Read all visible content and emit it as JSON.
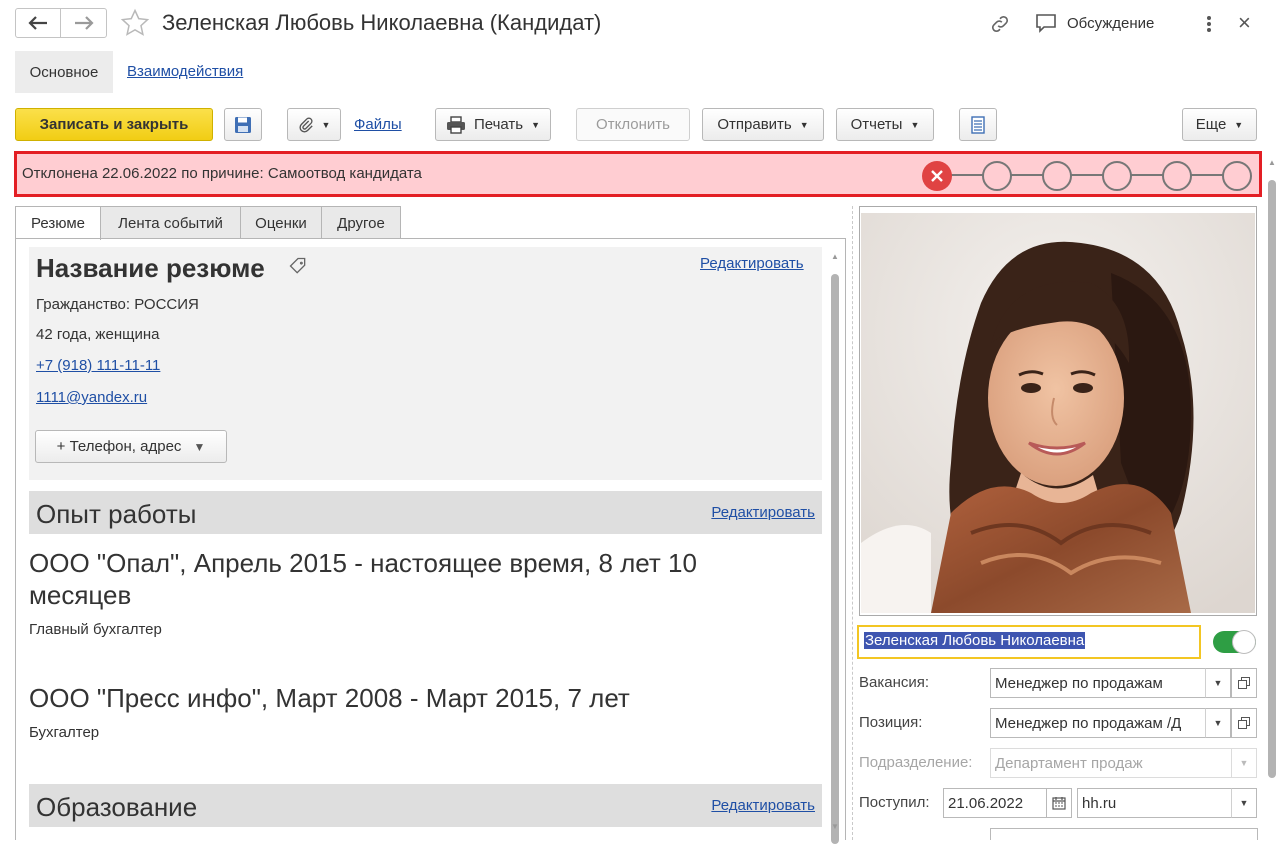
{
  "window": {
    "title": "Зеленская Любовь Николаевна (Кандидат)",
    "discussion_label": "Обсуждение"
  },
  "nav": {
    "main_label": "Основное",
    "interactions_label": "Взаимодействия"
  },
  "toolbar": {
    "save_close": "Записать и закрыть",
    "files": "Файлы",
    "print": "Печать",
    "reject": "Отклонить",
    "send": "Отправить",
    "reports": "Отчеты",
    "more": "Еще"
  },
  "status": {
    "text": "Отклонена 22.06.2022 по причине: Самоотвод кандидата",
    "bg_color": "#ffcdd2",
    "border_color": "#e31e24",
    "stages_total": 6,
    "stage_rejected": 1
  },
  "tabs": [
    "Резюме",
    "Лента событий",
    "Оценки",
    "Другое"
  ],
  "resume": {
    "title": "Название резюме",
    "edit": "Редактировать",
    "citizenship": "Гражданство: РОССИЯ",
    "age": "42 года, женщина",
    "phone": "+7 (918) 111-11-11",
    "email": "1111@yandex.ru",
    "add_contact": "+ Телефон, адрес"
  },
  "experience": {
    "title": "Опыт работы",
    "edit": "Редактировать",
    "jobs": [
      {
        "heading": "ООО \"Опал\", Апрель 2015 - настоящее время, 8 лет 10 месяцев",
        "position": "Главный бухгалтер"
      },
      {
        "heading": "ООО \"Пресс инфо\", Март 2008 - Март 2015, 7 лет",
        "position": "Бухгалтер"
      }
    ]
  },
  "education": {
    "title": "Образование",
    "edit": "Редактировать"
  },
  "candidate": {
    "name": "Зеленская Любовь Николаевна",
    "toggle_on": true,
    "vacancy_label": "Вакансия:",
    "vacancy": "Менеджер по продажам",
    "position_label": "Позиция:",
    "position": "Менеджер по продажам /Д",
    "department_label": "Подразделение:",
    "department": "Департамент продаж",
    "received_label": "Поступил:",
    "received_date": "21.06.2022",
    "source": "hh.ru"
  },
  "colors": {
    "accent_yellow": "#f7d529",
    "link": "#1f4fa5",
    "toggle_green": "#2e9e44",
    "reject_red": "#e04343"
  }
}
